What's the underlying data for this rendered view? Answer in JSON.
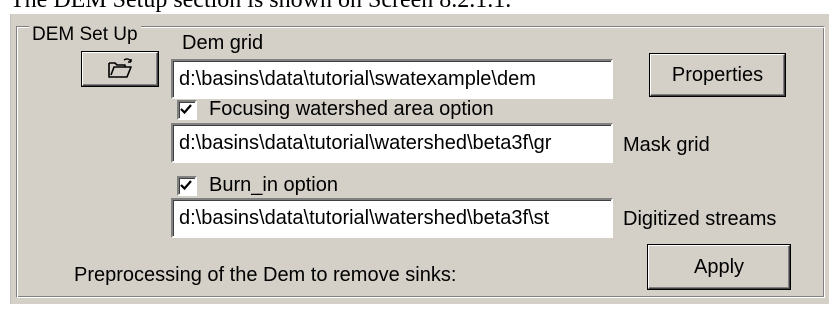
{
  "caption": {
    "text": "The DEM Setup section is shown on Screen 8.2.1.1."
  },
  "group": {
    "title": "DEM Set Up"
  },
  "dem": {
    "label": "Dem grid",
    "value": "d:\\basins\\data\\tutorial\\swatexample\\dem",
    "browse_icon": "open-folder-icon",
    "properties_label": "Properties"
  },
  "focus": {
    "checkbox_label": "Focusing watershed  area option",
    "checked": true,
    "value": "d:\\basins\\data\\tutorial\\watershed\\beta3f\\gr",
    "side_label": "Mask grid"
  },
  "burn": {
    "checkbox_label": "Burn_in option",
    "checked": true,
    "value": "d:\\basins\\data\\tutorial\\watershed\\beta3f\\st",
    "side_label": "Digitized streams"
  },
  "preprocess": {
    "label": "Preprocessing of the Dem to remove sinks:",
    "apply_label": "Apply"
  },
  "colors": {
    "dialog_bg": "#d4d0c8",
    "field_bg": "#ffffff",
    "text": "#000000"
  }
}
